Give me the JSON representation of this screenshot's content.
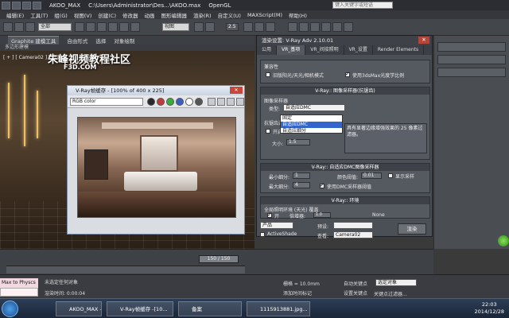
{
  "window": {
    "tabs": [
      "AKOO_MAX",
      "C:\\Users\\Administrator\\Des...\\AKOO.max",
      "OpenGL"
    ],
    "search_placeholder": "键入关键字或短语"
  },
  "menu": [
    "编辑(E)",
    "工具(T)",
    "组(G)",
    "视图(V)",
    "创建(C)",
    "修改器",
    "动画",
    "图形编辑器",
    "渲染(R)",
    "自定义(U)",
    "MAXScript(M)",
    "帮助(H)"
  ],
  "toolbar": {
    "selection_filter": "全部",
    "view_dropdown": "视图",
    "snap_value": "2.5"
  },
  "ribbon": {
    "tabs": [
      "Graphite 建模工具",
      "自由形式",
      "选择",
      "对象绘制"
    ],
    "sub": "多边形建模"
  },
  "viewport": {
    "label": "[ + ] [ Camera02 ] [ 真实 ]"
  },
  "watermark": {
    "line1": "朱峰视频教程社区",
    "line2": "F3D.COM"
  },
  "framebuffer": {
    "title": "V-Ray帧缓存 - [100% of 400 x 225]",
    "channel": "RGB color",
    "close": "✕"
  },
  "dialog": {
    "title": "渲染设置: V-Ray Adv 2.10.01",
    "tabs": [
      "公用",
      "VR_基项",
      "VR_间接照明",
      "VR_设置",
      "Render Elements"
    ],
    "compat": {
      "label": "兼容性",
      "legacy": "旧版阳光/天光/相机模式",
      "use_3dsmax": "使用3dsMax光度学比例"
    },
    "sampler_head": "V-Ray:: 图像采样器(抗锯齿)",
    "sampler_label": "图像采样器",
    "type_label": "类型:",
    "type_value": "自适应DMC",
    "type_options": [
      "固定",
      "自适应DMC",
      "自适应细分"
    ],
    "aa_filter_label": "抗锯齿过滤器",
    "aa_on": "开启",
    "aa_size_label": "大小:",
    "aa_size_value": "1.5",
    "aa_info": "具有显著边缘增强效果的 25 像素过滤器。",
    "dmc_head": "V-Ray:: 自适应DMC图像采样器",
    "min_subdiv_label": "最小细分:",
    "min_subdiv_value": "1",
    "max_subdiv_label": "最大细分:",
    "max_subdiv_value": "4",
    "clr_thresh_label": "颜色阈值:",
    "clr_thresh_value": "0.01",
    "show_samples": "显示采样",
    "use_dmc": "使用DMC采样器阈值",
    "env_head": "V-Ray:: 环境",
    "gi_env_label": "全局照明环境 (天光) 覆盖",
    "gi_on": "开",
    "multiplier_label": "倍增器:",
    "multiplier_value": "1.0",
    "none_label": "None",
    "product_value": "产品",
    "preset_label": "预设:",
    "activeshade_label": "ActiveShade",
    "view_label": "查看:",
    "view_value": "Camera02",
    "render_button": "渲染"
  },
  "timeline": {
    "frame": "150 / 150"
  },
  "status": {
    "prompt": "未选定任何对象",
    "render_time": "渲染时间: 0:00:04",
    "grid": "栅格 = 10.0mm",
    "add_key": "添加时间标记",
    "auto_key": "自动关键点",
    "set_key": "设置关键点",
    "selected": "选定对象",
    "key_filters": "关键点过滤器...",
    "maxscript": "Max to Physcs"
  },
  "taskbar": {
    "tasks": [
      "AKOO_MAX -",
      "V-Ray帧缓存 -[10...",
      "备案",
      "1115913881.jpg..."
    ],
    "time": "22:03",
    "date": "2014/12/28"
  }
}
